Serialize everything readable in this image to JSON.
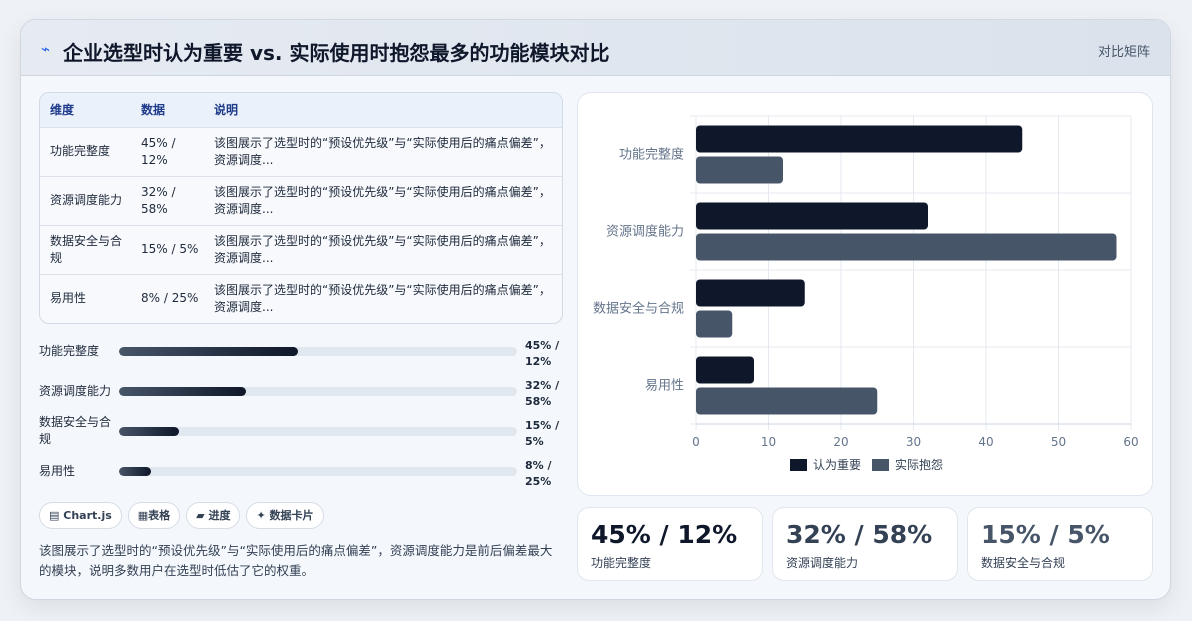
{
  "header": {
    "icon": "bolt-icon",
    "title": "企业选型时认为重要 vs. 实际使用时抱怨最多的功能模块对比",
    "tag": "对比矩阵"
  },
  "table": {
    "headers": [
      "维度",
      "数据",
      "说明"
    ],
    "rows": [
      {
        "dim": "功能完整度",
        "data": "45% / 12%",
        "desc": "该图展示了选型时的“预设优先级”与“实际使用后的痛点偏差”，资源调度..."
      },
      {
        "dim": "资源调度能力",
        "data": "32% / 58%",
        "desc": "该图展示了选型时的“预设优先级”与“实际使用后的痛点偏差”，资源调度..."
      },
      {
        "dim": "数据安全与合规",
        "data": "15% / 5%",
        "desc": "该图展示了选型时的“预设优先级”与“实际使用后的痛点偏差”，资源调度..."
      },
      {
        "dim": "易用性",
        "data": "8% / 25%",
        "desc": "该图展示了选型时的“预设优先级”与“实际使用后的痛点偏差”，资源调度..."
      }
    ]
  },
  "progress": [
    {
      "label": "功能完整度",
      "value": "45% / 12%",
      "fill": 0.45
    },
    {
      "label": "资源调度能力",
      "value": "32% / 58%",
      "fill": 0.32
    },
    {
      "label": "数据安全与合规",
      "value": "15% / 5%",
      "fill": 0.15
    },
    {
      "label": "易用性",
      "value": "8% / 25%",
      "fill": 0.08
    }
  ],
  "chips": [
    {
      "icon": "chart-icon",
      "glyph": "▤",
      "label": "Chart.js"
    },
    {
      "icon": "table-icon",
      "glyph": "▦",
      "label": "表格"
    },
    {
      "icon": "progress-icon",
      "glyph": "▰",
      "label": "进度"
    },
    {
      "icon": "card-icon",
      "glyph": "✦",
      "label": "数据卡片"
    }
  ],
  "summary": "该图展示了选型时的“预设优先级”与“实际使用后的痛点偏差”，资源调度能力是前后偏差最大的模块，说明多数用户在选型时低估了它的权重。",
  "stats": [
    {
      "value": "45% / 12%",
      "label": "功能完整度",
      "color": "#0f172a"
    },
    {
      "value": "32% / 58%",
      "label": "资源调度能力",
      "color": "#334155"
    },
    {
      "value": "15% / 5%",
      "label": "数据安全与合规",
      "color": "#475569"
    }
  ],
  "chart_data": {
    "type": "bar",
    "orientation": "horizontal",
    "categories": [
      "功能完整度",
      "资源调度能力",
      "数据安全与合规",
      "易用性"
    ],
    "series": [
      {
        "name": "认为重要",
        "values": [
          45,
          32,
          15,
          8
        ],
        "color": "#0f172a"
      },
      {
        "name": "实际抱怨",
        "values": [
          12,
          58,
          5,
          25
        ],
        "color": "#475569"
      }
    ],
    "xlim": [
      0,
      60
    ],
    "xticks": [
      0,
      10,
      20,
      30,
      40,
      50,
      60
    ],
    "grid": true,
    "legend": "bottom"
  }
}
